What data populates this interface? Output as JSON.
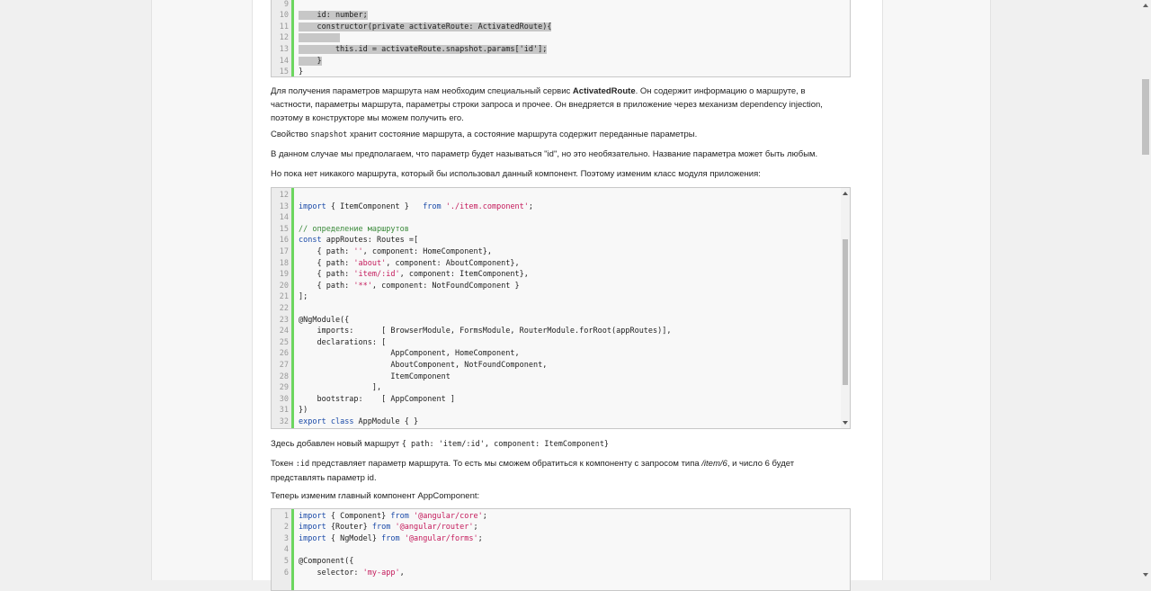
{
  "code_block_1": {
    "lines": [
      {
        "n": "9",
        "text": ""
      },
      {
        "n": "10",
        "text": "    id: number;"
      },
      {
        "n": "11",
        "text": "    constructor(private activateRoute: ActivatedRoute){"
      },
      {
        "n": "12",
        "text": "         "
      },
      {
        "n": "13",
        "text": "        this.id = activateRoute.snapshot.params['id'];"
      },
      {
        "n": "14",
        "text": "    }"
      },
      {
        "n": "15",
        "text": "}"
      }
    ]
  },
  "para1": {
    "before": "Для получения параметров маршрута нам необходим специальный сервис ",
    "bold": "ActivatedRoute",
    "after": ". Он содержит информацию о маршруте, в частности, параметры маршрута, параметры строки запроса и прочее. Он внедряется в приложение через механизм dependency injection, поэтому в конструкторе мы можем получить его."
  },
  "para2": {
    "before": "Свойство ",
    "code": "snapshot",
    "after": " хранит состояние маршрута, а состояние маршрута содержит переданные параметры."
  },
  "para3": "В данном случае мы предполагаем, что параметр будет называться \"id\", но это необязательно. Название параметра может быть любым.",
  "para4": "Но пока нет никакого маршрута, который бы использовал данный компонент. Поэтому изменим класс модуля приложения:",
  "code_block_2": {
    "lines": [
      {
        "n": "12",
        "text": ""
      },
      {
        "n": "13",
        "text": "import { ItemComponent }   from './item.component';"
      },
      {
        "n": "14",
        "text": ""
      },
      {
        "n": "15",
        "text": "// определение маршрутов"
      },
      {
        "n": "16",
        "text": "const appRoutes: Routes =["
      },
      {
        "n": "17",
        "text": "    { path: '', component: HomeComponent},"
      },
      {
        "n": "18",
        "text": "    { path: 'about', component: AboutComponent},"
      },
      {
        "n": "19",
        "text": "    { path: 'item/:id', component: ItemComponent},"
      },
      {
        "n": "20",
        "text": "    { path: '**', component: NotFoundComponent }"
      },
      {
        "n": "21",
        "text": "];"
      },
      {
        "n": "22",
        "text": ""
      },
      {
        "n": "23",
        "text": "@NgModule({"
      },
      {
        "n": "24",
        "text": "    imports:      [ BrowserModule, FormsModule, RouterModule.forRoot(appRoutes)],"
      },
      {
        "n": "25",
        "text": "    declarations: ["
      },
      {
        "n": "26",
        "text": "                    AppComponent, HomeComponent,"
      },
      {
        "n": "27",
        "text": "                    AboutComponent, NotFoundComponent,"
      },
      {
        "n": "28",
        "text": "                    ItemComponent"
      },
      {
        "n": "29",
        "text": "                ],"
      },
      {
        "n": "30",
        "text": "    bootstrap:    [ AppComponent ]"
      },
      {
        "n": "31",
        "text": "})"
      },
      {
        "n": "32",
        "text": "export class AppModule { }"
      }
    ]
  },
  "para5": {
    "before": "Здесь добавлен новый маршрут ",
    "code": "{ path: 'item/:id', component: ItemComponent}"
  },
  "para6": {
    "before": "Токен ",
    "code": ":id",
    "middle": " представляет параметр маршрута. То есть мы сможем обратиться к компоненту с запросом типа ",
    "italic": "/item/6",
    "after": ", и число 6 будет представлять параметр id."
  },
  "para7": "Теперь изменим главный компонент AppComponent:",
  "code_block_3": {
    "lines": [
      {
        "n": "1",
        "text": "import { Component} from '@angular/core';"
      },
      {
        "n": "2",
        "text": "import {Router} from '@angular/router';"
      },
      {
        "n": "3",
        "text": "import { NgModel} from '@angular/forms';"
      },
      {
        "n": "4",
        "text": ""
      },
      {
        "n": "5",
        "text": "@Component({"
      },
      {
        "n": "6",
        "text": "    selector: 'my-app',"
      }
    ]
  },
  "scroll": {
    "code_block_2_position": 0.55
  }
}
